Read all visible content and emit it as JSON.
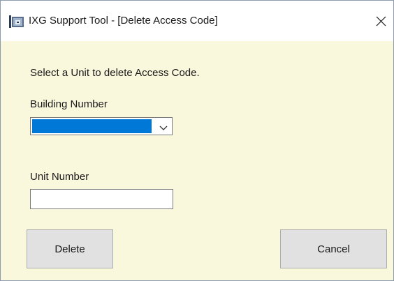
{
  "window": {
    "title": "IXG Support Tool - [Delete Access Code]",
    "app_icon": "app-icon",
    "close_icon": "close-icon",
    "background_color": "#f9f7dc"
  },
  "form": {
    "instruction": "Select a Unit to delete Access Code.",
    "building_label": "Building Number",
    "building_selected": "",
    "building_selected_color": "#0078d7",
    "unit_label": "Unit Number",
    "unit_value": ""
  },
  "buttons": {
    "delete_label": "Delete",
    "cancel_label": "Cancel"
  }
}
